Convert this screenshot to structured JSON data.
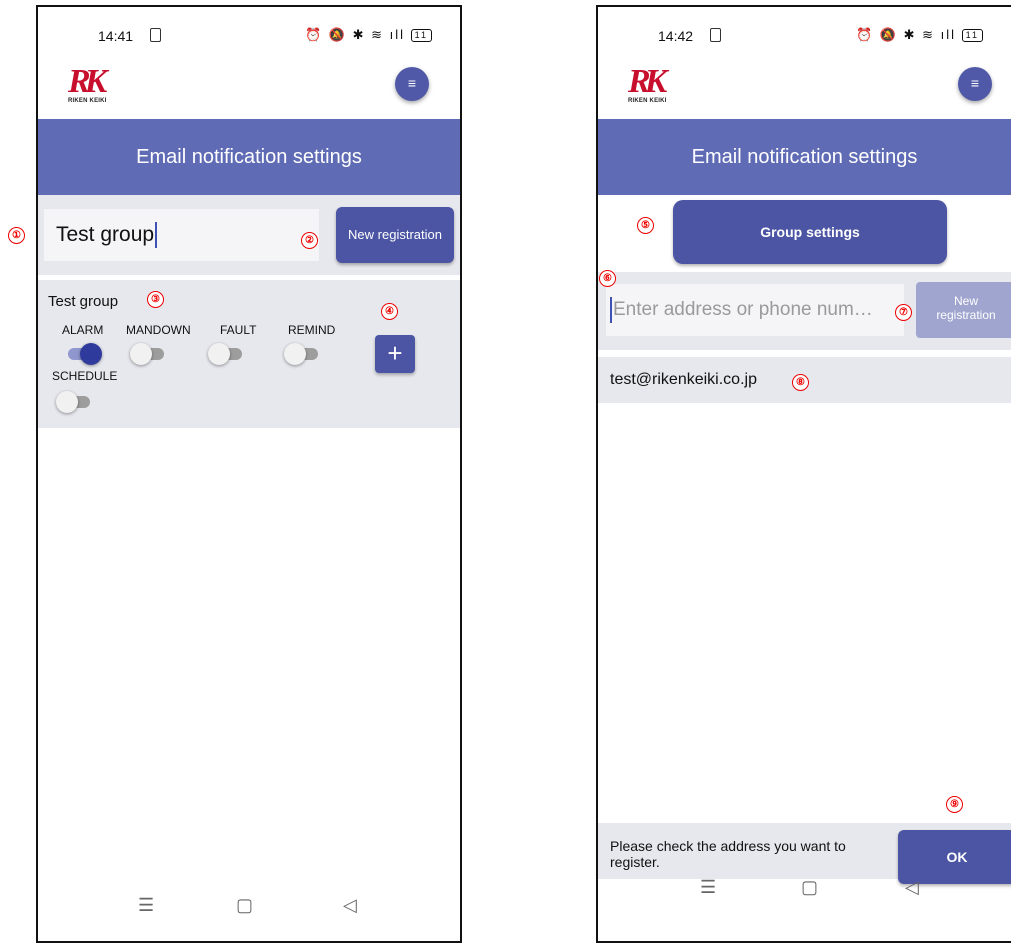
{
  "screen1": {
    "status": {
      "time": "14:41",
      "icons": "⏰ 🔕 ✱ ≋ ıll",
      "battery": "11"
    },
    "logo": {
      "mark": "RK",
      "caption": "RIKEN KEIKI"
    },
    "menu_icon": "≡",
    "header_title": "Email notification settings",
    "group_input_value": "Test group",
    "new_registration_label": "New registration",
    "group": {
      "name": "Test group",
      "toggles": [
        {
          "label": "ALARM",
          "on": true
        },
        {
          "label": "MANDOWN",
          "on": false
        },
        {
          "label": "FAULT",
          "on": false
        },
        {
          "label": "REMIND",
          "on": false
        },
        {
          "label": "SCHEDULE",
          "on": false
        }
      ],
      "add_label": "+"
    },
    "nav": {
      "recents": "☰",
      "home": "▢",
      "back": "◁"
    }
  },
  "screen2": {
    "status": {
      "time": "14:42",
      "icons": "⏰ 🔕 ✱ ≋ ıll",
      "battery": "11"
    },
    "logo": {
      "mark": "RK",
      "caption": "RIKEN KEIKI"
    },
    "menu_icon": "≡",
    "header_title": "Email notification settings",
    "group_settings_label": "Group settings",
    "address_input_placeholder": "Enter address or phone num…",
    "new_registration_label": {
      "line1": "New",
      "line2": "registration"
    },
    "email_entry": "test@rikenkeiki.co.jp",
    "bottom_message": "Please check the address you want to register.",
    "ok_label": "OK",
    "nav": {
      "recents": "☰",
      "home": "▢",
      "back": "◁"
    }
  },
  "annotations": [
    "①",
    "②",
    "③",
    "④",
    "⑤",
    "⑥",
    "⑦",
    "⑧",
    "⑨"
  ],
  "colors": {
    "header": "#5f6bb5",
    "button": "#4b55a3",
    "marker": "#e00000",
    "panel": "#e7e8ee"
  }
}
